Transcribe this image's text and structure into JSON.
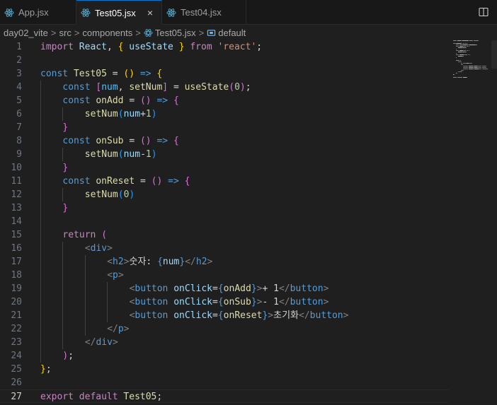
{
  "tabs": [
    {
      "label": "App.jsx",
      "active": false
    },
    {
      "label": "Test05.jsx",
      "active": true
    },
    {
      "label": "Test04.jsx",
      "active": false
    }
  ],
  "tab_close_glyph": "×",
  "breadcrumb": {
    "items": [
      "day02_vite",
      "src",
      "components",
      "Test05.jsx",
      "default"
    ],
    "separator": ">"
  },
  "editor": {
    "current_line": 27,
    "lines": [
      {
        "n": "1",
        "indent": 0,
        "tokens": [
          [
            "k1",
            "import"
          ],
          [
            "tx",
            " "
          ],
          [
            "vr",
            "React"
          ],
          [
            "tx",
            ", "
          ],
          [
            "b1",
            "{"
          ],
          [
            "tx",
            " "
          ],
          [
            "vr",
            "useState"
          ],
          [
            "tx",
            " "
          ],
          [
            "b1",
            "}"
          ],
          [
            "tx",
            " "
          ],
          [
            "k1",
            "from"
          ],
          [
            "tx",
            " "
          ],
          [
            "st",
            "'react'"
          ],
          [
            "tx",
            ";"
          ]
        ]
      },
      {
        "n": "2",
        "indent": 0,
        "tokens": []
      },
      {
        "n": "3",
        "indent": 0,
        "tokens": [
          [
            "k2",
            "const"
          ],
          [
            "tx",
            " "
          ],
          [
            "fn",
            "Test05"
          ],
          [
            "tx",
            " = "
          ],
          [
            "b1",
            "()"
          ],
          [
            "tx",
            " "
          ],
          [
            "k2",
            "=>"
          ],
          [
            "tx",
            " "
          ],
          [
            "b1",
            "{"
          ]
        ]
      },
      {
        "n": "4",
        "indent": 1,
        "tokens": [
          [
            "k2",
            "const"
          ],
          [
            "tx",
            " "
          ],
          [
            "b2",
            "["
          ],
          [
            "cs",
            "num"
          ],
          [
            "tx",
            ", "
          ],
          [
            "fn",
            "setNum"
          ],
          [
            "b2",
            "]"
          ],
          [
            "tx",
            " = "
          ],
          [
            "fn",
            "useState"
          ],
          [
            "b2",
            "("
          ],
          [
            "nm",
            "0"
          ],
          [
            "b2",
            ")"
          ],
          [
            "tx",
            ";"
          ]
        ]
      },
      {
        "n": "5",
        "indent": 1,
        "tokens": [
          [
            "k2",
            "const"
          ],
          [
            "tx",
            " "
          ],
          [
            "fn",
            "onAdd"
          ],
          [
            "tx",
            " = "
          ],
          [
            "b2",
            "()"
          ],
          [
            "tx",
            " "
          ],
          [
            "k2",
            "=>"
          ],
          [
            "tx",
            " "
          ],
          [
            "b2",
            "{"
          ]
        ]
      },
      {
        "n": "6",
        "indent": 2,
        "tokens": [
          [
            "fn",
            "setNum"
          ],
          [
            "b3",
            "("
          ],
          [
            "vr",
            "num"
          ],
          [
            "tx",
            "+"
          ],
          [
            "nm",
            "1"
          ],
          [
            "b3",
            ")"
          ]
        ]
      },
      {
        "n": "7",
        "indent": 1,
        "tokens": [
          [
            "b2",
            "}"
          ]
        ]
      },
      {
        "n": "8",
        "indent": 1,
        "tokens": [
          [
            "k2",
            "const"
          ],
          [
            "tx",
            " "
          ],
          [
            "fn",
            "onSub"
          ],
          [
            "tx",
            " = "
          ],
          [
            "b2",
            "()"
          ],
          [
            "tx",
            " "
          ],
          [
            "k2",
            "=>"
          ],
          [
            "tx",
            " "
          ],
          [
            "b2",
            "{"
          ]
        ]
      },
      {
        "n": "9",
        "indent": 2,
        "tokens": [
          [
            "fn",
            "setNum"
          ],
          [
            "b3",
            "("
          ],
          [
            "vr",
            "num"
          ],
          [
            "tx",
            "-"
          ],
          [
            "nm",
            "1"
          ],
          [
            "b3",
            ")"
          ]
        ]
      },
      {
        "n": "10",
        "indent": 1,
        "tokens": [
          [
            "b2",
            "}"
          ]
        ]
      },
      {
        "n": "11",
        "indent": 1,
        "tokens": [
          [
            "k2",
            "const"
          ],
          [
            "tx",
            " "
          ],
          [
            "fn",
            "onReset"
          ],
          [
            "tx",
            " = "
          ],
          [
            "b2",
            "()"
          ],
          [
            "tx",
            " "
          ],
          [
            "k2",
            "=>"
          ],
          [
            "tx",
            " "
          ],
          [
            "b2",
            "{"
          ]
        ]
      },
      {
        "n": "12",
        "indent": 2,
        "tokens": [
          [
            "fn",
            "setNum"
          ],
          [
            "b3",
            "("
          ],
          [
            "nm",
            "0"
          ],
          [
            "b3",
            ")"
          ]
        ]
      },
      {
        "n": "13",
        "indent": 1,
        "tokens": [
          [
            "b2",
            "}"
          ]
        ]
      },
      {
        "n": "14",
        "indent": 0,
        "tokens": []
      },
      {
        "n": "15",
        "indent": 1,
        "tokens": [
          [
            "k1",
            "return"
          ],
          [
            "tx",
            " "
          ],
          [
            "b2",
            "("
          ]
        ]
      },
      {
        "n": "16",
        "indent": 2,
        "tokens": [
          [
            "ag",
            "<"
          ],
          [
            "tg",
            "div"
          ],
          [
            "ag",
            ">"
          ]
        ]
      },
      {
        "n": "17",
        "indent": 3,
        "tokens": [
          [
            "ag",
            "<"
          ],
          [
            "tg",
            "h2"
          ],
          [
            "ag",
            ">"
          ],
          [
            "tx",
            "숫자: "
          ],
          [
            "k2",
            "{"
          ],
          [
            "vr",
            "num"
          ],
          [
            "k2",
            "}"
          ],
          [
            "ag",
            "</"
          ],
          [
            "tg",
            "h2"
          ],
          [
            "ag",
            ">"
          ]
        ]
      },
      {
        "n": "18",
        "indent": 3,
        "tokens": [
          [
            "ag",
            "<"
          ],
          [
            "tg",
            "p"
          ],
          [
            "ag",
            ">"
          ]
        ]
      },
      {
        "n": "19",
        "indent": 4,
        "tokens": [
          [
            "ag",
            "<"
          ],
          [
            "tg",
            "button"
          ],
          [
            "tx",
            " "
          ],
          [
            "vr",
            "onClick"
          ],
          [
            "tx",
            "="
          ],
          [
            "k2",
            "{"
          ],
          [
            "fn",
            "onAdd"
          ],
          [
            "k2",
            "}"
          ],
          [
            "ag",
            ">"
          ],
          [
            "tx",
            "+ 1"
          ],
          [
            "ag",
            "</"
          ],
          [
            "tg",
            "button"
          ],
          [
            "ag",
            ">"
          ]
        ]
      },
      {
        "n": "20",
        "indent": 4,
        "tokens": [
          [
            "ag",
            "<"
          ],
          [
            "tg",
            "button"
          ],
          [
            "tx",
            " "
          ],
          [
            "vr",
            "onClick"
          ],
          [
            "tx",
            "="
          ],
          [
            "k2",
            "{"
          ],
          [
            "fn",
            "onSub"
          ],
          [
            "k2",
            "}"
          ],
          [
            "ag",
            ">"
          ],
          [
            "tx",
            "- 1"
          ],
          [
            "ag",
            "</"
          ],
          [
            "tg",
            "button"
          ],
          [
            "ag",
            ">"
          ]
        ]
      },
      {
        "n": "21",
        "indent": 4,
        "tokens": [
          [
            "ag",
            "<"
          ],
          [
            "tg",
            "button"
          ],
          [
            "tx",
            " "
          ],
          [
            "vr",
            "onClick"
          ],
          [
            "tx",
            "="
          ],
          [
            "k2",
            "{"
          ],
          [
            "fn",
            "onReset"
          ],
          [
            "k2",
            "}"
          ],
          [
            "ag",
            ">"
          ],
          [
            "tx",
            "초기화"
          ],
          [
            "ag",
            "</"
          ],
          [
            "tg",
            "button"
          ],
          [
            "ag",
            ">"
          ]
        ]
      },
      {
        "n": "22",
        "indent": 3,
        "tokens": [
          [
            "ag",
            "</"
          ],
          [
            "tg",
            "p"
          ],
          [
            "ag",
            ">"
          ]
        ]
      },
      {
        "n": "23",
        "indent": 2,
        "tokens": [
          [
            "ag",
            "</"
          ],
          [
            "tg",
            "div"
          ],
          [
            "ag",
            ">"
          ]
        ]
      },
      {
        "n": "24",
        "indent": 1,
        "tokens": [
          [
            "b2",
            ")"
          ],
          [
            "tx",
            ";"
          ]
        ]
      },
      {
        "n": "25",
        "indent": 0,
        "tokens": [
          [
            "b1",
            "}"
          ],
          [
            "tx",
            ";"
          ]
        ]
      },
      {
        "n": "26",
        "indent": 0,
        "tokens": []
      },
      {
        "n": "27",
        "indent": 0,
        "tokens": [
          [
            "k1",
            "export"
          ],
          [
            "tx",
            " "
          ],
          [
            "k1",
            "default"
          ],
          [
            "tx",
            " "
          ],
          [
            "fn",
            "Test05"
          ],
          [
            "tx",
            ";"
          ]
        ]
      }
    ]
  }
}
